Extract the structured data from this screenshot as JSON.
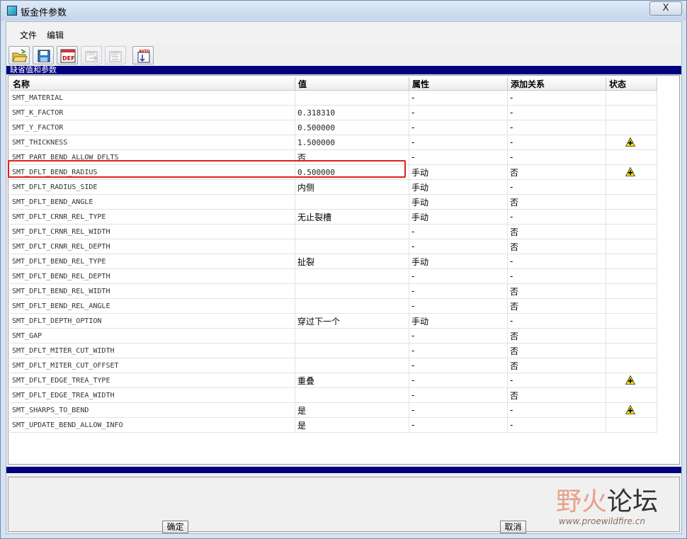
{
  "window": {
    "title": "钣金件参数",
    "close_label": "X"
  },
  "menu": {
    "file": "文件",
    "edit": "编辑"
  },
  "toolbar": {
    "def_label": "DEF",
    "auto_label": "AUTO"
  },
  "section": {
    "title": "缺省值和参数"
  },
  "table": {
    "headers": {
      "name": "名称",
      "value": "值",
      "attribute": "属性",
      "relation": "添加关系",
      "status": "状态"
    },
    "rows": [
      {
        "name": "SMT_MATERIAL",
        "value": "",
        "attribute": "-",
        "relation": "-",
        "status": ""
      },
      {
        "name": "SMT_K_FACTOR",
        "value": "0.318310",
        "attribute": "-",
        "relation": "-",
        "status": ""
      },
      {
        "name": "SMT_Y_FACTOR",
        "value": "0.500000",
        "attribute": "-",
        "relation": "-",
        "status": ""
      },
      {
        "name": "SMT_THICKNESS",
        "value": "1.500000",
        "attribute": "-",
        "relation": "-",
        "status": "warning"
      },
      {
        "name": "SMT_PART_BEND_ALLOW_DFLTS",
        "value": "否",
        "attribute": "-",
        "relation": "-",
        "status": ""
      },
      {
        "name": "SMT_DFLT_BEND_RADIUS",
        "value": "0.500000",
        "attribute": "手动",
        "relation": "否",
        "status": "warning"
      },
      {
        "name": "SMT_DFLT_RADIUS_SIDE",
        "value": "内侧",
        "attribute": "手动",
        "relation": "-",
        "status": ""
      },
      {
        "name": "SMT_DFLT_BEND_ANGLE",
        "value": "",
        "attribute": "手动",
        "relation": "否",
        "status": ""
      },
      {
        "name": "SMT_DFLT_CRNR_REL_TYPE",
        "value": "无止裂槽",
        "attribute": "手动",
        "relation": "-",
        "status": ""
      },
      {
        "name": "SMT_DFLT_CRNR_REL_WIDTH",
        "value": "",
        "attribute": "-",
        "relation": "否",
        "status": ""
      },
      {
        "name": "SMT_DFLT_CRNR_REL_DEPTH",
        "value": "",
        "attribute": "-",
        "relation": "否",
        "status": ""
      },
      {
        "name": "SMT_DFLT_BEND_REL_TYPE",
        "value": "扯裂",
        "attribute": "手动",
        "relation": "-",
        "status": ""
      },
      {
        "name": "SMT_DFLT_BEND_REL_DEPTH",
        "value": "",
        "attribute": "-",
        "relation": "-",
        "status": ""
      },
      {
        "name": "SMT_DFLT_BEND_REL_WIDTH",
        "value": "",
        "attribute": "-",
        "relation": "否",
        "status": ""
      },
      {
        "name": "SMT_DFLT_BEND_REL_ANGLE",
        "value": "",
        "attribute": "-",
        "relation": "否",
        "status": ""
      },
      {
        "name": "SMT_DFLT_DEPTH_OPTION",
        "value": "穿过下一个",
        "attribute": "手动",
        "relation": "-",
        "status": ""
      },
      {
        "name": "SMT_GAP",
        "value": "",
        "attribute": "-",
        "relation": "否",
        "status": ""
      },
      {
        "name": "SMT_DFLT_MITER_CUT_WIDTH",
        "value": "",
        "attribute": "-",
        "relation": "否",
        "status": ""
      },
      {
        "name": "SMT_DFLT_MITER_CUT_OFFSET",
        "value": "",
        "attribute": "-",
        "relation": "否",
        "status": ""
      },
      {
        "name": "SMT_DFLT_EDGE_TREA_TYPE",
        "value": "重叠",
        "attribute": "-",
        "relation": "-",
        "status": "warning"
      },
      {
        "name": "SMT_DFLT_EDGE_TREA_WIDTH",
        "value": "",
        "attribute": "-",
        "relation": "否",
        "status": ""
      },
      {
        "name": "SMT_SHARPS_TO_BEND",
        "value": "是",
        "attribute": "-",
        "relation": "-",
        "status": "warning"
      },
      {
        "name": "SMT_UPDATE_BEND_ALLOW_INFO",
        "value": "是",
        "attribute": "-",
        "relation": "-",
        "status": ""
      }
    ]
  },
  "buttons": {
    "ok": "确定",
    "cancel": "取消"
  },
  "watermark": {
    "part1": "野火",
    "part2": "论坛",
    "sub": "www.proewildfire.cn"
  },
  "colors": {
    "section_bar": "#000080",
    "highlight": "#e02020",
    "warning_icon": "#f5e000"
  }
}
